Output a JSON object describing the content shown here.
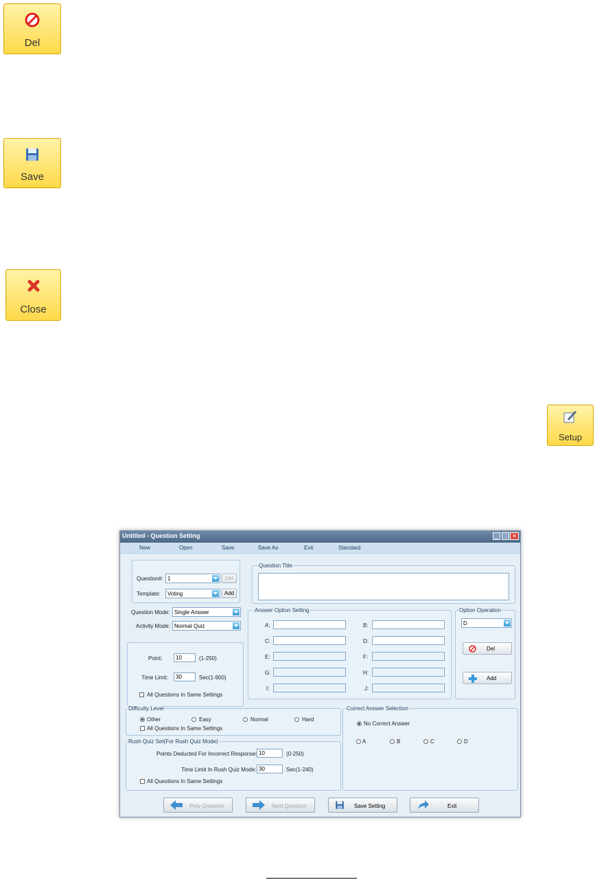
{
  "buttons": {
    "del": "Del",
    "save": "Save",
    "close": "Close",
    "setup": "Setup"
  },
  "window": {
    "title": "Untitled - Question Setting",
    "menu": [
      "New",
      "Open",
      "Save",
      "Save As",
      "Exit",
      "Standard"
    ],
    "question": {
      "number_label": "Question#:",
      "number_value": "1",
      "del_label": "Del",
      "template_label": "Template:",
      "template_value": "Voting",
      "add_label": "Add"
    },
    "mode": {
      "question_mode_label": "Question Mode:",
      "question_mode_value": "Single Answer",
      "activity_mode_label": "Activity Mode:",
      "activity_mode_value": "Normal Quiz"
    },
    "scoring": {
      "point_label": "Point:",
      "point_value": "10",
      "point_range": "(1-250)",
      "time_label": "Time Limit:",
      "time_value": "30",
      "time_range": "Sec(1-900)",
      "same_label": "All Questions In Same Settings"
    },
    "question_title": {
      "legend": "Question Title"
    },
    "answer_options": {
      "legend": "Answer Option Setting",
      "options": [
        "A:",
        "B:",
        "C:",
        "D:",
        "E:",
        "F:",
        "G:",
        "H:",
        "I:",
        "J:"
      ]
    },
    "option_operation": {
      "legend": "Option Operation",
      "selected": "D",
      "del_label": "Del",
      "add_label": "Add"
    },
    "difficulty": {
      "legend": "Difficulty Level",
      "levels": [
        "Other",
        "Easy",
        "Normal",
        "Hard"
      ],
      "same_label": "All Questions In Same Settings"
    },
    "rush": {
      "legend": "Rush Quiz Set(For Rush Quiz Mode)",
      "deduct_label": "Points Deducted For Incorrect Response:",
      "deduct_value": "10",
      "deduct_range": "(0-250)",
      "time_label": "Time Limit In Rush Quiz Mode:",
      "time_value": "30",
      "time_range": "Sec(1-240)",
      "same_label": "All Questions In Same Settings"
    },
    "correct": {
      "legend": "Correct Answer Selection",
      "none_label": "No Correct Answer",
      "choices": [
        "A",
        "B",
        "C",
        "D"
      ]
    },
    "bottom": {
      "prev": "Prev Question",
      "next": "Next Question",
      "save": "Save Setting",
      "exit": "Exit"
    }
  },
  "colors": {
    "accent_yellow": "#ffd94a",
    "titlebar": "#4d6886",
    "window_bg": "#e6eef6"
  }
}
